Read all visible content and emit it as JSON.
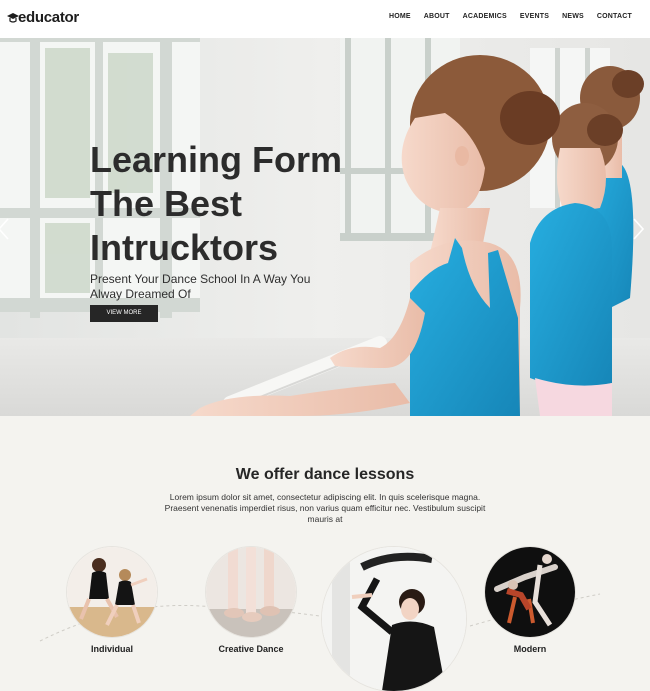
{
  "header": {
    "logo_text": "educator",
    "nav": [
      "HOME",
      "ABOUT",
      "ACADEMICS",
      "EVENTS",
      "NEWS",
      "CONTACT"
    ]
  },
  "hero": {
    "title_lines": [
      "Learning Form",
      "The Best",
      "Intrucktors"
    ],
    "subtitle": "Present Your Dance School In A Way You Alway Dreamed Of",
    "button_label": "VIEW MORE"
  },
  "lessons": {
    "title": "We offer dance lessons",
    "text": "Lorem ipsum dolor sit amet, consectetur adipiscing elit. In quis scelerisque magna. Praesent venenatis imperdiet risus, non varius quam efficitur nec. Vestibulum suscipit mauris at",
    "items": [
      {
        "label": "Individual"
      },
      {
        "label": "Creative Dance"
      },
      {
        "label": ""
      },
      {
        "label": "Modern"
      }
    ]
  },
  "colors": {
    "accent_dark": "#262626",
    "leotard_blue": "#1e9fd0",
    "section_bg": "#f4f3ef"
  }
}
